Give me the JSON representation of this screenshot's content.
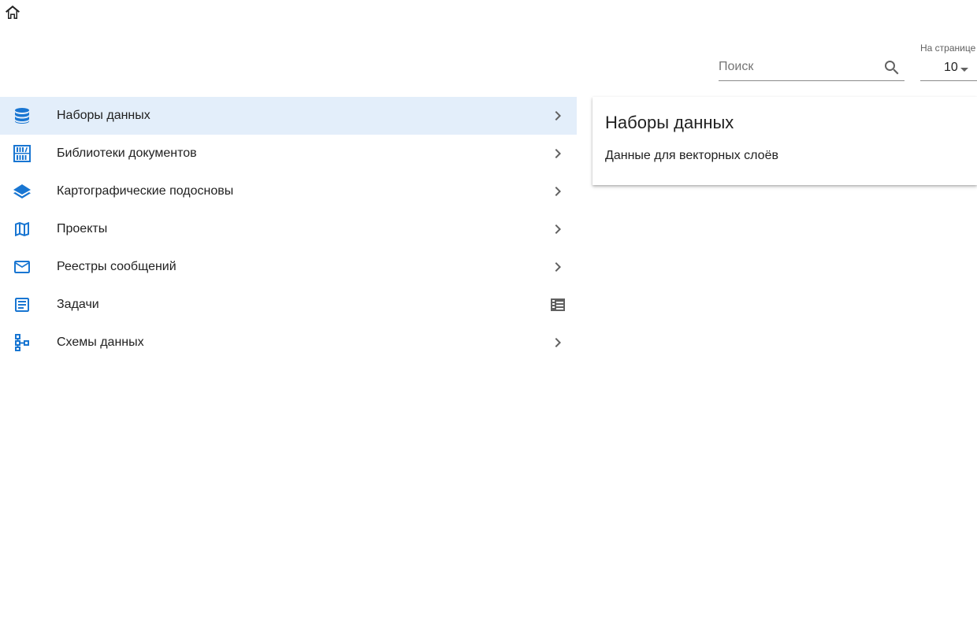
{
  "header": {
    "home_icon": "home-icon"
  },
  "toolbar": {
    "search": {
      "placeholder": "Поиск",
      "value": "",
      "icon": "search-icon"
    },
    "per_page": {
      "label": "На странице",
      "value": "10",
      "icon": "arrow-drop-down-icon"
    }
  },
  "nav": {
    "accent_color": "#1976d2",
    "selected_bg": "#e3eefa",
    "items": [
      {
        "label": "Наборы данных",
        "icon": "database-icon",
        "trailing": "chevron-right-icon",
        "selected": true
      },
      {
        "label": "Библиотеки документов",
        "icon": "document-library-icon",
        "trailing": "chevron-right-icon",
        "selected": false
      },
      {
        "label": "Картографические подосновы",
        "icon": "layers-icon",
        "trailing": "chevron-right-icon",
        "selected": false
      },
      {
        "label": "Проекты",
        "icon": "map-icon",
        "trailing": "chevron-right-icon",
        "selected": false
      },
      {
        "label": "Реестры сообщений",
        "icon": "mail-icon",
        "trailing": "chevron-right-icon",
        "selected": false
      },
      {
        "label": "Задачи",
        "icon": "article-icon",
        "trailing": "table-list-icon",
        "selected": false
      },
      {
        "label": "Схемы данных",
        "icon": "schema-icon",
        "trailing": "chevron-right-icon",
        "selected": false
      }
    ]
  },
  "info_card": {
    "title": "Наборы данных",
    "description": "Данные для векторных слоёв"
  }
}
